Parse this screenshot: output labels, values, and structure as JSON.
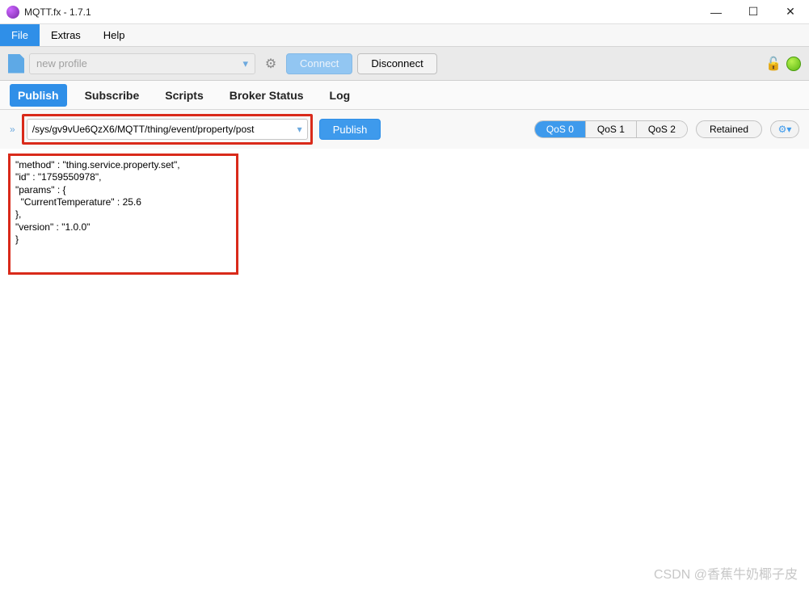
{
  "titlebar": {
    "title": "MQTT.fx - 1.7.1"
  },
  "menubar": {
    "file": "File",
    "extras": "Extras",
    "help": "Help"
  },
  "toolbar": {
    "profile_placeholder": "new profile",
    "connect": "Connect",
    "disconnect": "Disconnect"
  },
  "tabs": {
    "publish": "Publish",
    "subscribe": "Subscribe",
    "scripts": "Scripts",
    "broker_status": "Broker Status",
    "log": "Log"
  },
  "publish": {
    "topic": "/sys/gv9vUe6QzX6/MQTT/thing/event/property/post",
    "button": "Publish",
    "qos0": "QoS 0",
    "qos1": "QoS 1",
    "qos2": "QoS 2",
    "retained": "Retained",
    "gear_label": "⚙▾"
  },
  "payload": "\"method\" : \"thing.service.property.set\",\n\"id\" : \"1759550978\",\n\"params\" : {\n  \"CurrentTemperature\" : 25.6\n},\n\"version\" : \"1.0.0\"\n}",
  "watermark": "CSDN @香蕉牛奶椰子皮"
}
